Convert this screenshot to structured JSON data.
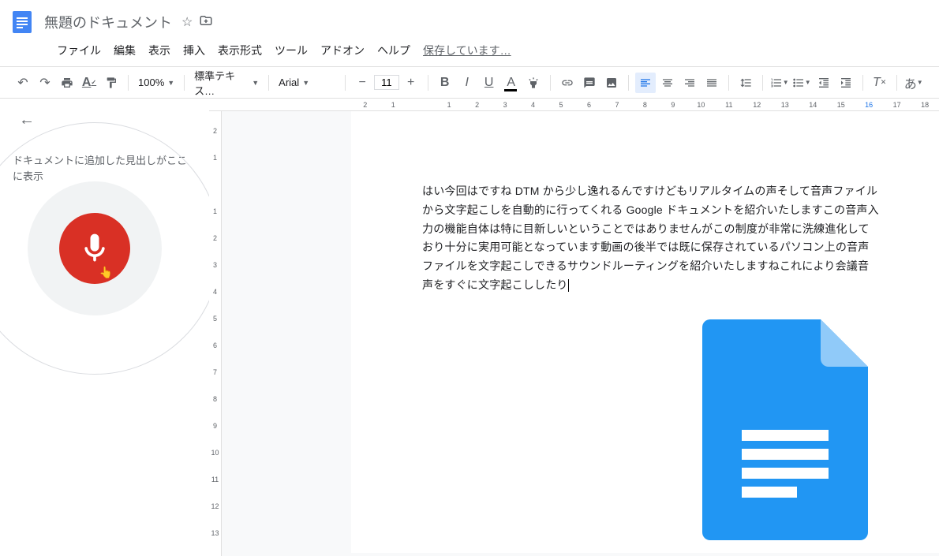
{
  "header": {
    "title": "無題のドキュメント",
    "saving": "保存しています…"
  },
  "menus": {
    "file": "ファイル",
    "edit": "編集",
    "view": "表示",
    "insert": "挿入",
    "format": "表示形式",
    "tools": "ツール",
    "addons": "アドオン",
    "help": "ヘルプ"
  },
  "toolbar": {
    "zoom": "100%",
    "style": "標準テキス…",
    "font": "Arial",
    "fontsize": "11",
    "input_mode": "あ"
  },
  "sidebar": {
    "outline_hint": "ドキュメントに追加した見出しがここに表示"
  },
  "document": {
    "body": "はい今回はですね DTM から少し逸れるんですけどもリアルタイムの声そして音声ファイルから文字起こしを自動的に行ってくれる Google ドキュメントを紹介いたしますこの音声入力の機能自体は特に目新しいということではありませんがこの制度が非常に洗練進化しており十分に実用可能となっています動画の後半では既に保存されているパソコン上の音声ファイルを文字起こしできるサウンドルーティングを紹介いたしますねこれにより会議音声をすぐに文字起こししたり"
  },
  "ruler_h": [
    "2",
    "1",
    "",
    "1",
    "2",
    "3",
    "4",
    "5",
    "6",
    "7",
    "8",
    "9",
    "10",
    "11",
    "12",
    "13",
    "14",
    "15",
    "16",
    "17",
    "18"
  ],
  "ruler_v": [
    "2",
    "1",
    "",
    "1",
    "2",
    "3",
    "4",
    "5",
    "6",
    "7",
    "8",
    "9",
    "10",
    "11",
    "12",
    "13"
  ]
}
